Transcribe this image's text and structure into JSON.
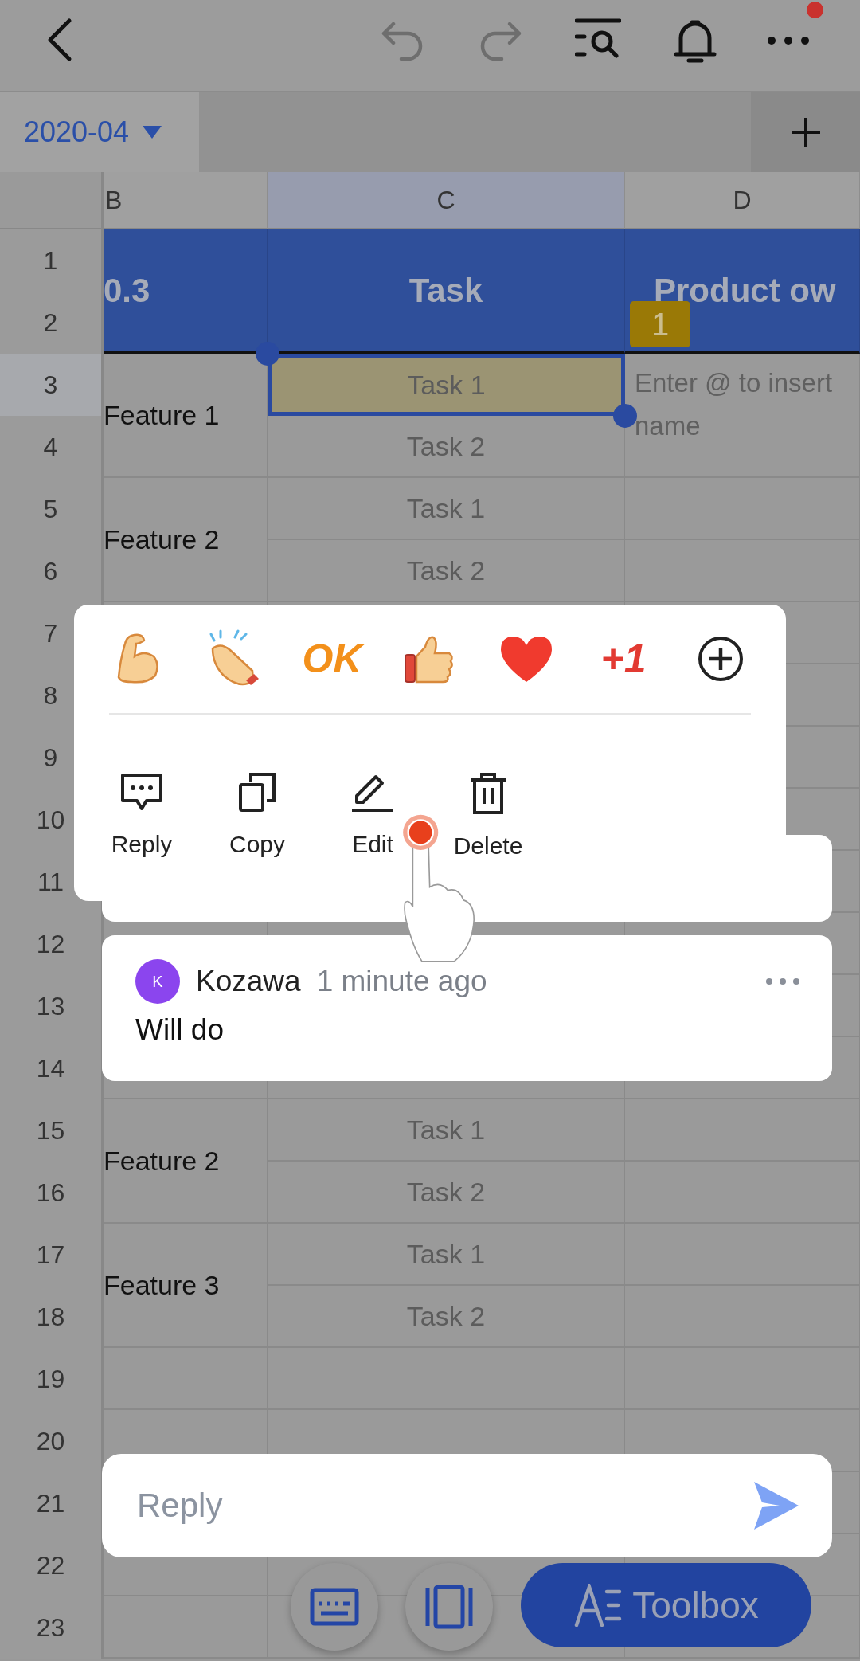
{
  "sheet_tabs": [
    {
      "label": "2020-04",
      "selected": true
    }
  ],
  "columns": [
    {
      "label": "B",
      "selected": false
    },
    {
      "label": "C",
      "selected": true
    },
    {
      "label": "D",
      "selected": false
    }
  ],
  "rows": [
    {
      "number": "1",
      "header": [
        "0.3",
        "Task",
        "Product ow"
      ]
    },
    {
      "number": "2"
    },
    {
      "number": "3",
      "feature": "Feature 1",
      "task": {
        "label": "Task 1",
        "selected": true
      },
      "owner": {
        "placeholder": "Enter @ to insert name",
        "comment_count": "1"
      }
    },
    {
      "number": "4",
      "task": {
        "label": "Task 2",
        "selected": false
      }
    },
    {
      "number": "5",
      "feature": "Feature 2",
      "task": {
        "label": "Task 1",
        "selected": false
      }
    },
    {
      "number": "6",
      "task": {
        "label": "Task 2",
        "selected": false
      }
    },
    {
      "number": "7"
    },
    {
      "number": "8"
    },
    {
      "number": "9"
    },
    {
      "number": "10"
    },
    {
      "number": "11"
    },
    {
      "number": "12"
    },
    {
      "number": "13"
    },
    {
      "number": "14"
    },
    {
      "number": "15",
      "feature": "Feature 2",
      "task": {
        "label": "Task 1",
        "selected": false
      }
    },
    {
      "number": "16",
      "task": {
        "label": "Task 2",
        "selected": false
      }
    },
    {
      "number": "17",
      "feature": "Feature 3",
      "task": {
        "label": "Task 1",
        "selected": false
      }
    },
    {
      "number": "18",
      "task": {
        "label": "Task 2",
        "selected": false
      }
    },
    {
      "number": "19"
    },
    {
      "number": "20"
    },
    {
      "number": "21"
    },
    {
      "number": "22"
    },
    {
      "number": "23"
    }
  ],
  "reactions": [
    {
      "kind": "muscle"
    },
    {
      "kind": "clap"
    },
    {
      "kind": "ok_text",
      "label": "OK"
    },
    {
      "kind": "thumbs"
    },
    {
      "kind": "heart"
    },
    {
      "kind": "plus_text",
      "label": "+1"
    },
    {
      "kind": "add"
    }
  ],
  "actions": [
    {
      "kind": "reply",
      "label": "Reply"
    },
    {
      "kind": "copy",
      "label": "Copy"
    },
    {
      "kind": "edit",
      "label": "Edit"
    },
    {
      "kind": "delete",
      "label": "Delete"
    }
  ],
  "comment": {
    "initial": "K",
    "author": "Kozawa",
    "time": "1 minute ago",
    "text": "Will do"
  },
  "reply_field": {
    "placeholder": "Reply"
  },
  "toolbox": {
    "label": "Toolbox"
  }
}
